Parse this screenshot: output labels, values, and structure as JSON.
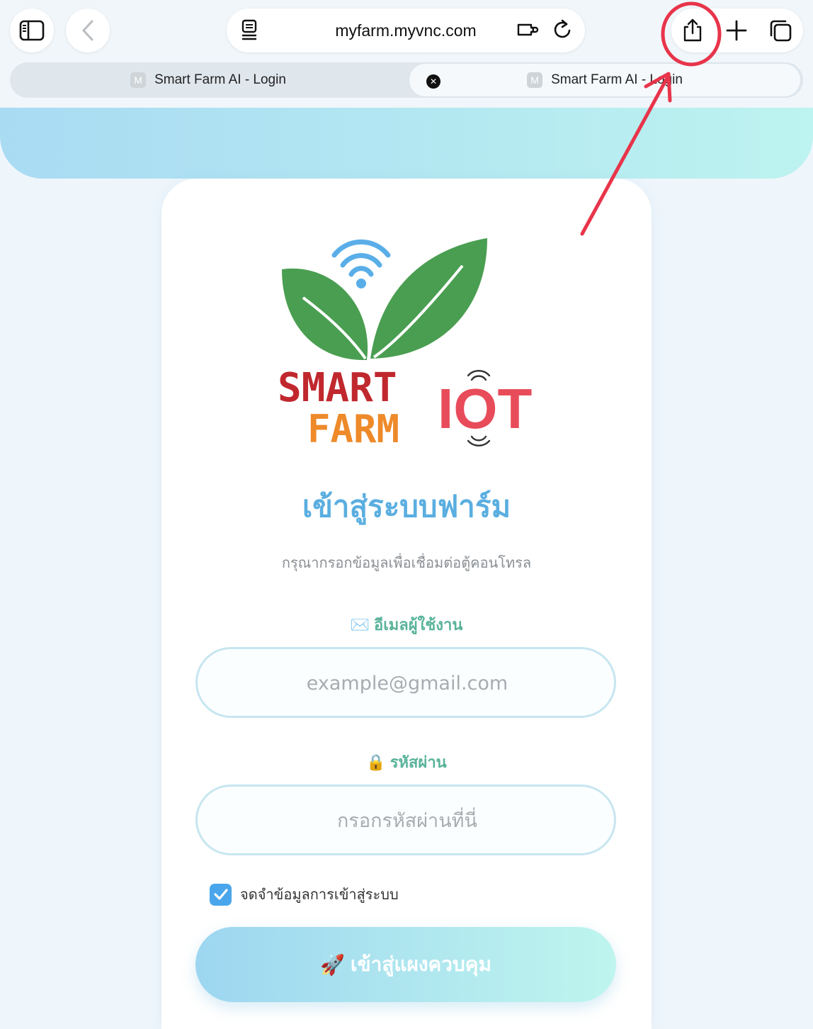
{
  "browser": {
    "url": "myfarm.myvnc.com",
    "tabs": [
      {
        "title": "Smart Farm AI - Login",
        "favicon": "M",
        "active": false
      },
      {
        "title": "Smart Farm AI - Login",
        "favicon": "M",
        "active": true
      }
    ],
    "icons": [
      "sidebar-icon",
      "back-icon",
      "reader-icon",
      "extensions-icon",
      "reload-icon",
      "share-icon",
      "new-tab-icon",
      "tabs-overview-icon",
      "close-tab-icon"
    ]
  },
  "logo": {
    "line1": "SMART",
    "line2": "FARM",
    "badge": "IOT"
  },
  "login": {
    "title": "เข้าสู่ระบบฟาร์ม",
    "subtitle": "กรุณากรอกข้อมูลเพื่อเชื่อมต่อตู้คอนโทรล",
    "email_label": "อีเมลผู้ใช้งาน",
    "email_emoji": "✉️",
    "email_placeholder": "example@gmail.com",
    "password_label": "รหัสผ่าน",
    "password_emoji": "🔒",
    "password_placeholder": "กรอกรหัสผ่านที่นี่",
    "remember_label": "จดจำข้อมูลการเข้าสู่ระบบ",
    "remember_checked": true,
    "submit_emoji": "🚀",
    "submit_label": "เข้าสู่แผงควบคุม"
  },
  "colors": {
    "accent_blue": "#5aaee0",
    "label_green": "#59b39a",
    "annotation_red": "#e8344a"
  }
}
